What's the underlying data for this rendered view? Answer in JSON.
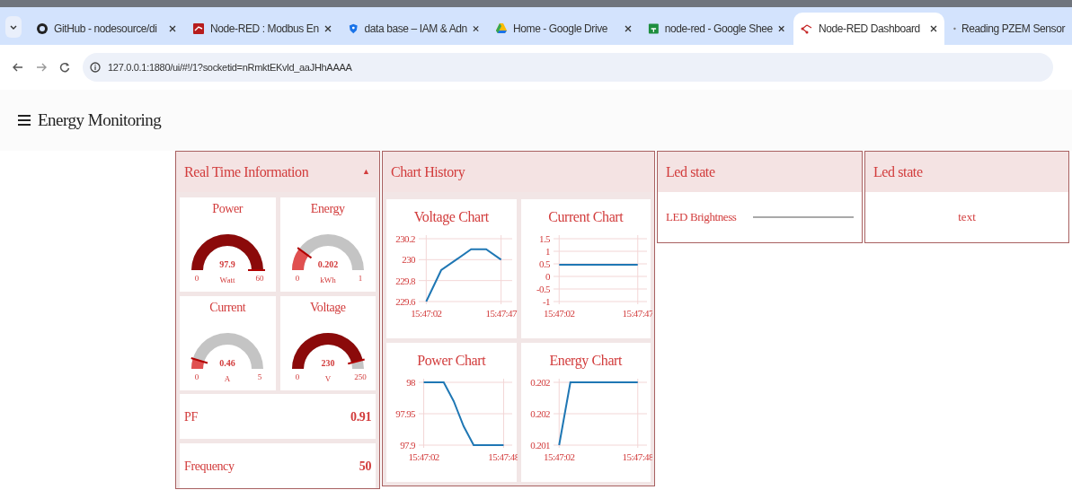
{
  "browser": {
    "tabs": [
      {
        "title": "GitHub - nodesource/di",
        "selected": false
      },
      {
        "title": "Node-RED : Modbus En",
        "selected": false
      },
      {
        "title": "data base – IAM & Adn",
        "selected": false
      },
      {
        "title": "Home - Google Drive",
        "selected": false
      },
      {
        "title": "node-red - Google Shee",
        "selected": false
      },
      {
        "title": "Node-RED Dashboard",
        "selected": true
      },
      {
        "title": "Reading PZEM Sensor",
        "selected": false
      }
    ],
    "url": "127.0.0.1:1880/ui/#!/1?socketid=nRmktEKvld_aaJHhAAAA"
  },
  "page_title": "Energy Monitoring",
  "groups": [
    {
      "kind": "gauges",
      "title": "Real Time Information",
      "collapse_icon": "▲",
      "gauges": [
        {
          "title": "Power",
          "value": "97.9",
          "min": "0",
          "max": "60",
          "unit": "Watt"
        },
        {
          "title": "Energy",
          "value": "0.202",
          "min": "0",
          "max": "1",
          "unit": "kWh"
        },
        {
          "title": "Current",
          "value": "0.46",
          "min": "0",
          "max": "5",
          "unit": "A"
        },
        {
          "title": "Voltage",
          "value": "230",
          "min": "0",
          "max": "250",
          "unit": "V"
        }
      ],
      "readings": [
        {
          "label": "PF",
          "value": "0.91"
        },
        {
          "label": "Frequency",
          "value": "50"
        }
      ]
    },
    {
      "kind": "charts",
      "title": "Chart History",
      "charts": [
        {
          "title": "Voltage Chart",
          "chart_data": {
            "type": "line",
            "grid": true,
            "categories": [
              "15:47:02",
              null,
              null,
              null,
              null,
              "15:47:47"
            ],
            "series": [
              {
                "color": "#1f77b4",
                "values": [
                  229.6,
                  229.9,
                  230.0,
                  230.1,
                  230.1,
                  230.0
                ]
              }
            ],
            "ylim": [
              229.6,
              230.2
            ],
            "yticks": [
              229.6,
              229.8,
              230,
              230.2
            ]
          }
        },
        {
          "title": "Current Chart",
          "chart_data": {
            "type": "line",
            "grid": true,
            "categories": [
              "15:47:02",
              null,
              null,
              null,
              null,
              null,
              null,
              "15:47:47"
            ],
            "series": [
              {
                "color": "#1f77b4",
                "values": [
                  0.46,
                  0.46,
                  0.46,
                  0.46,
                  0.46,
                  0.46,
                  0.46,
                  0.46
                ]
              }
            ],
            "ylim": [
              -1,
              1.5
            ],
            "yticks": [
              -1,
              -0.5,
              0,
              0.5,
              1,
              1.5
            ]
          }
        },
        {
          "title": "Power Chart",
          "chart_data": {
            "type": "line",
            "grid": true,
            "categories": [
              "15:47:02",
              null,
              null,
              null,
              null,
              null,
              null,
              null,
              "15:47:48"
            ],
            "series": [
              {
                "color": "#1f77b4",
                "values": [
                  98,
                  98,
                  98,
                  97.97,
                  97.93,
                  97.9,
                  97.9,
                  97.9,
                  97.9
                ]
              }
            ],
            "ylim": [
              97.9,
              98
            ],
            "yticks": [
              97.9,
              97.95,
              98
            ]
          }
        },
        {
          "title": "Energy Chart",
          "chart_data": {
            "type": "line",
            "grid": true,
            "categories": [
              "15:47:02",
              null,
              null,
              null,
              null,
              null,
              null,
              "15:47:48"
            ],
            "series": [
              {
                "color": "#1f77b4",
                "values": [
                  0.2015,
                  0.202,
                  0.202,
                  0.202,
                  0.202,
                  0.202,
                  0.202,
                  0.202
                ]
              }
            ],
            "ylim": [
              0.2015,
              0.202
            ],
            "yticks": [
              {
                "value": 0.2015,
                "label": "0.201"
              },
              {
                "value": 0.20175,
                "label": "0.202"
              },
              {
                "value": 0.202,
                "label": "0.202"
              }
            ]
          }
        }
      ]
    },
    {
      "kind": "slider",
      "title": "Led state",
      "label": "LED Brightness"
    },
    {
      "kind": "text",
      "title": "Led state",
      "text": "text"
    }
  ]
}
